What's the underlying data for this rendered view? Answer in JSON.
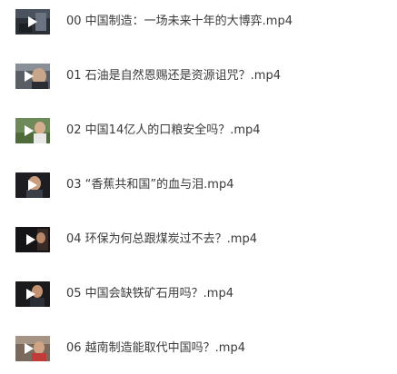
{
  "files": [
    {
      "name": "00 中国制造：一场未来十年的大博弈.mp4",
      "thumb_icon": "video-thumbnail-icon"
    },
    {
      "name": "01 石油是自然恩赐还是资源诅咒？.mp4",
      "thumb_icon": "video-thumbnail-icon"
    },
    {
      "name": "02 中国14亿人的口粮安全吗？.mp4",
      "thumb_icon": "video-thumbnail-icon"
    },
    {
      "name": "03 “香蕉共和国”的血与泪.mp4",
      "thumb_icon": "video-thumbnail-icon"
    },
    {
      "name": "04 环保为何总跟煤炭过不去？.mp4",
      "thumb_icon": "video-thumbnail-icon"
    },
    {
      "name": "05 中国会缺铁矿石用吗？.mp4",
      "thumb_icon": "video-thumbnail-icon"
    },
    {
      "name": "06 越南制造能取代中国吗？.mp4",
      "thumb_icon": "video-thumbnail-icon"
    }
  ],
  "colors": {
    "text": "#3a3a3a",
    "background": "#ffffff",
    "play_badge": "#ffffff"
  }
}
